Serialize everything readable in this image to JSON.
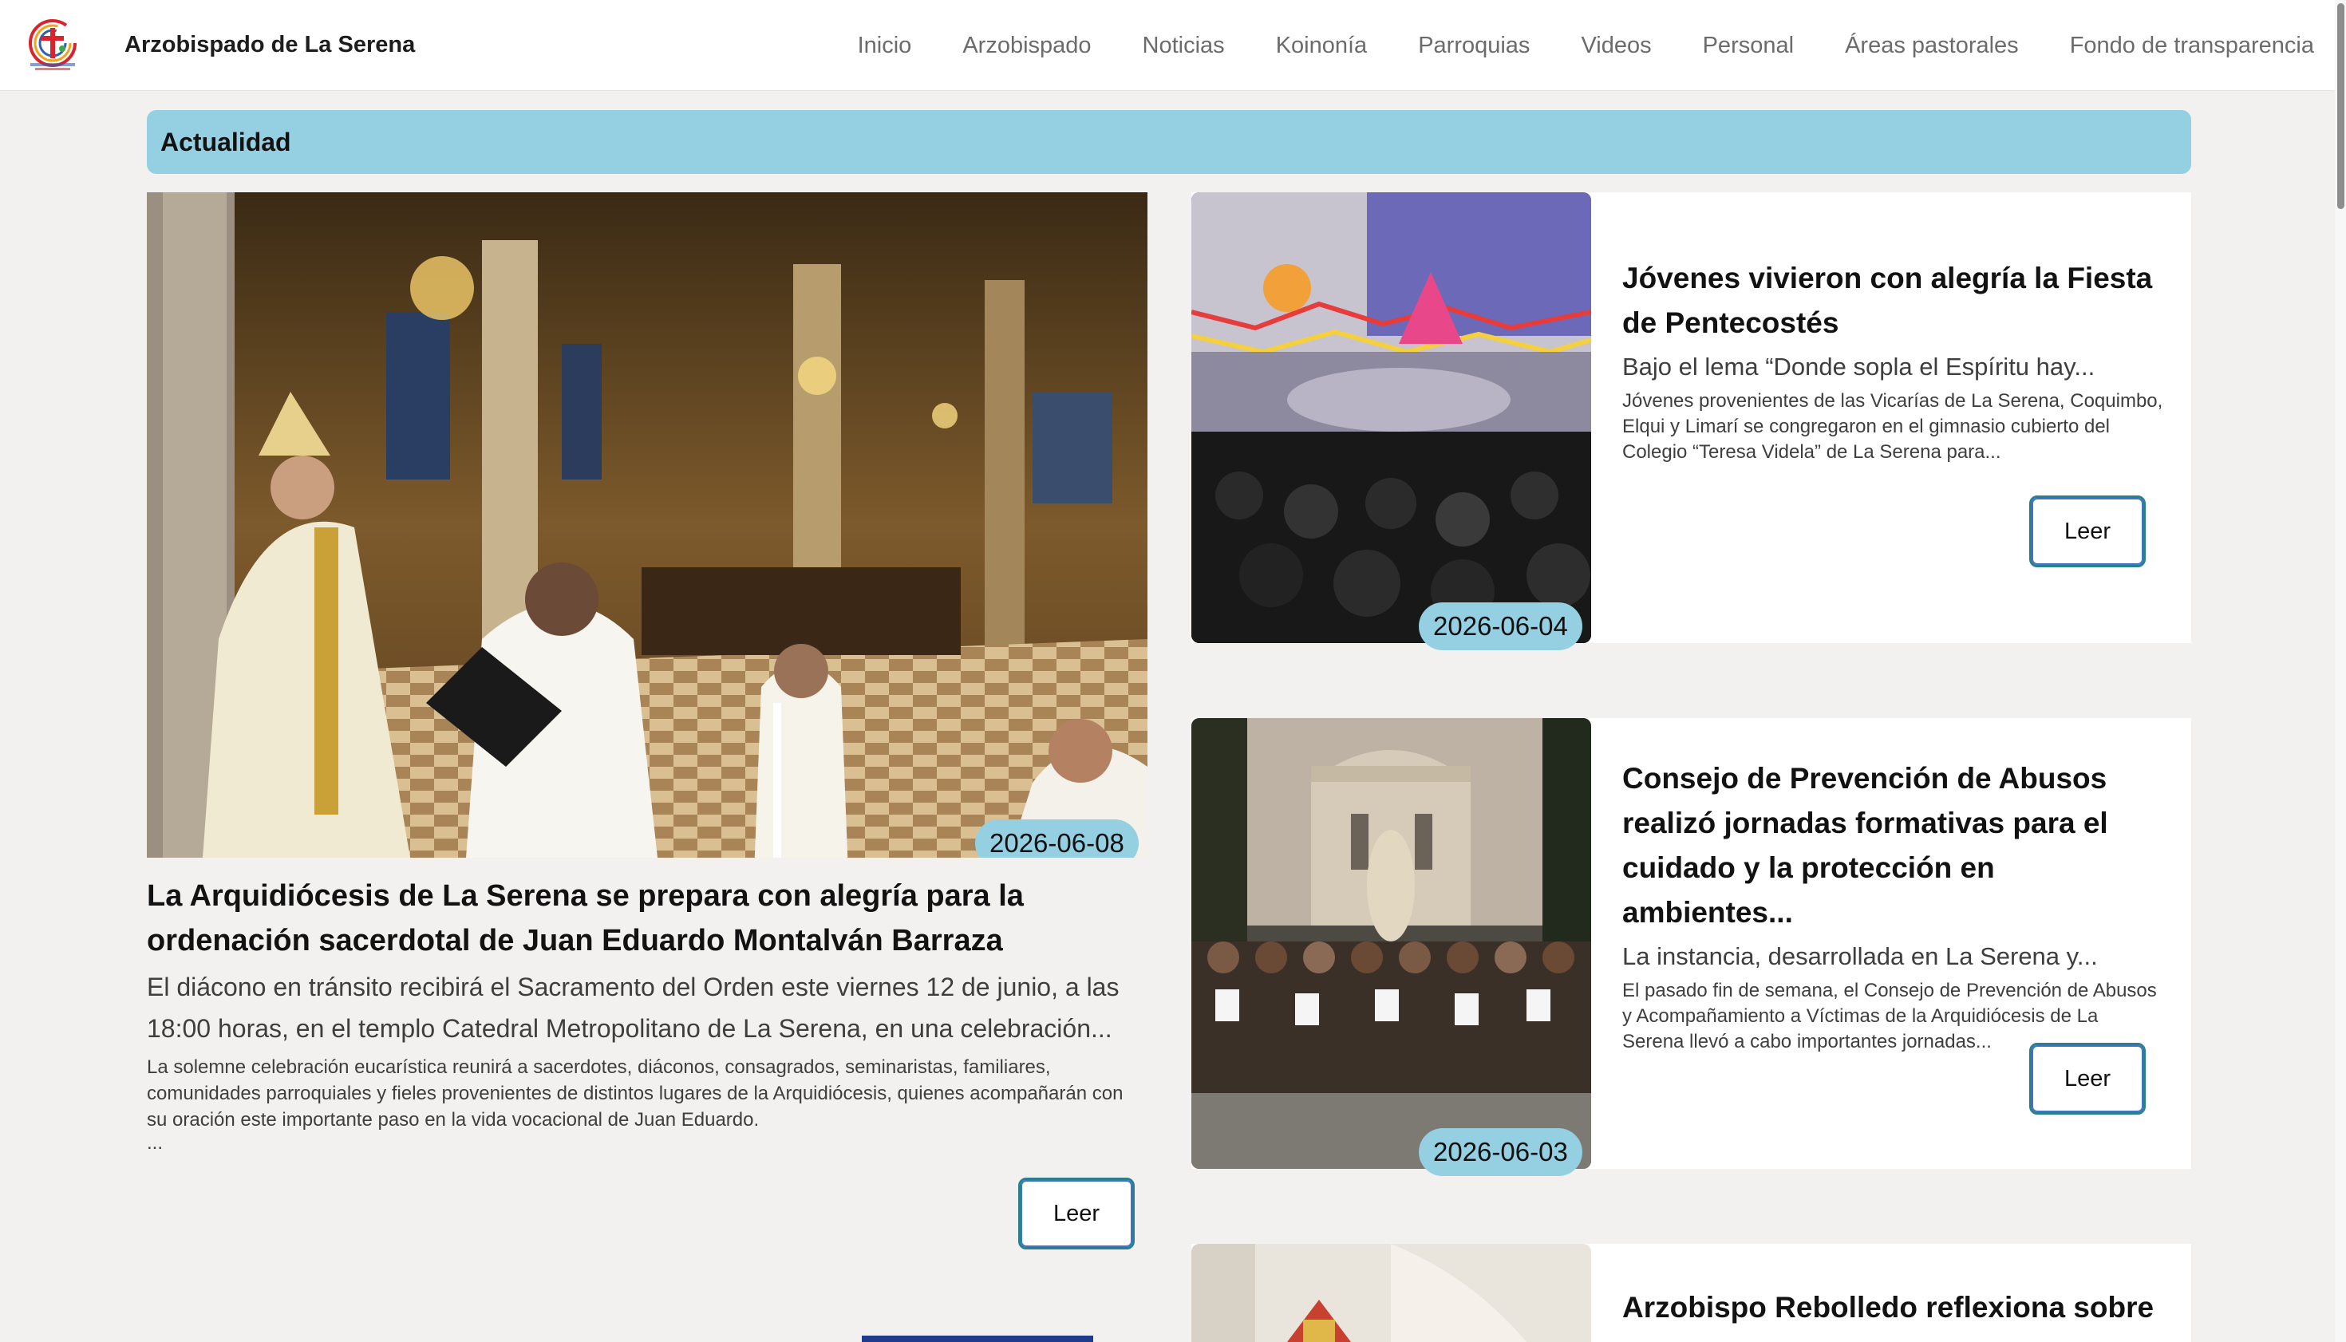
{
  "site": {
    "logo_text": "ARZOBISPADO LA SERENA",
    "brand_name": "Arzobispado de La Serena"
  },
  "nav": {
    "items": [
      {
        "label": "Inicio"
      },
      {
        "label": "Arzobispado"
      },
      {
        "label": "Noticias"
      },
      {
        "label": "Koinonía"
      },
      {
        "label": "Parroquias"
      },
      {
        "label": "Videos"
      },
      {
        "label": "Personal"
      },
      {
        "label": "Áreas pastorales"
      },
      {
        "label": "Fondo de transparencia"
      }
    ]
  },
  "section": {
    "title": "Actualidad"
  },
  "featured": {
    "date": "2026-06-08",
    "title": "La Arquidiócesis de La Serena se prepara con alegría para la ordenación sacerdotal de Juan Eduardo Montalván Barraza",
    "lead": "El diácono en tránsito recibirá el Sacramento del Orden este viernes 12 de junio, a las 18:00 horas, en el templo Catedral Metropolitano de La Serena, en una celebración...",
    "body": "La solemne celebración eucarística reunirá a sacerdotes, diáconos, consagrados, seminaristas, familiares, comunidades parroquiales y fieles provenientes de distintos lugares de la Arquidiócesis, quienes acompañarán con su oración este importante paso en la vida vocacional de Juan Eduardo.",
    "ellipsis": "...",
    "read_label": "Leer"
  },
  "cards": [
    {
      "date": "2026-06-04",
      "title": "Jóvenes vivieron con alegría la Fiesta de Pentecostés",
      "lead": "Bajo el lema “Donde sopla el Espíritu hay...",
      "body": "Jóvenes provenientes de las Vicarías de La Serena, Coquimbo, Elqui y Limarí se congregaron en el gimnasio cubierto del Colegio “Teresa Videla” de La Serena para...",
      "read_label": "Leer"
    },
    {
      "date": "2026-06-03",
      "title": "Consejo de Prevención de Abusos realizó jornadas formativas para el cuidado y la protección en ambientes...",
      "lead": "La instancia, desarrollada en La Serena y...",
      "body": "El pasado fin de semana, el Consejo de Prevención de Abusos y Acompañamiento a Víctimas de la Arquidiócesis de La Serena llevó a cabo importantes jornadas...",
      "read_label": "Leer"
    },
    {
      "title": "Arzobispo Rebolledo reflexiona sobre"
    }
  ],
  "colors": {
    "accent": "#95cfe2",
    "button_border": "#2a7f8c",
    "background": "#f3f0f0",
    "nav_text": "#6b6b6b"
  }
}
